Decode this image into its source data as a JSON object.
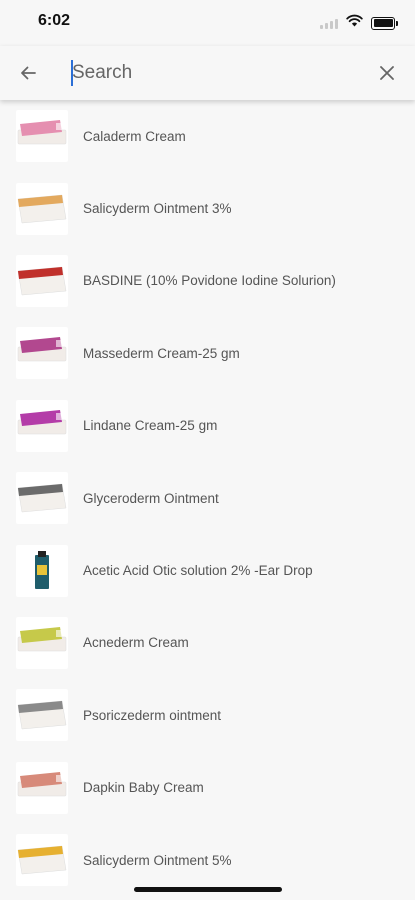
{
  "status": {
    "time": "6:02"
  },
  "search": {
    "placeholder": "Search",
    "value": ""
  },
  "items": [
    {
      "label": "Caladerm Cream",
      "icon": "cream-tube-icon",
      "color": "#e58fb0"
    },
    {
      "label": "Salicyderm Ointment 3%",
      "icon": "ointment-box-icon",
      "color": "#e3a95e"
    },
    {
      "label": "BASDINE (10% Povidone Iodine Solurion)",
      "icon": "solution-box-icon",
      "color": "#c0302b"
    },
    {
      "label": "Massederm Cream-25 gm",
      "icon": "cream-tube-icon",
      "color": "#b2488f"
    },
    {
      "label": "Lindane Cream-25 gm",
      "icon": "cream-tube-icon",
      "color": "#b43ca8"
    },
    {
      "label": "Glyceroderm Ointment",
      "icon": "ointment-box-icon",
      "color": "#6b6b6b"
    },
    {
      "label": "Acetic Acid Otic solution 2% -Ear Drop",
      "icon": "ear-drop-bottle-icon",
      "color": "#1f5d6b"
    },
    {
      "label": "Acnederm Cream",
      "icon": "cream-tube-icon",
      "color": "#c6c94a"
    },
    {
      "label": "Psoriczederm ointment",
      "icon": "ointment-box-icon",
      "color": "#8a8a8a"
    },
    {
      "label": "Dapkin Baby Cream",
      "icon": "cream-tube-icon",
      "color": "#d78a7a"
    },
    {
      "label": "Salicyderm Ointment 5%",
      "icon": "ointment-box-icon",
      "color": "#e6b030"
    }
  ]
}
